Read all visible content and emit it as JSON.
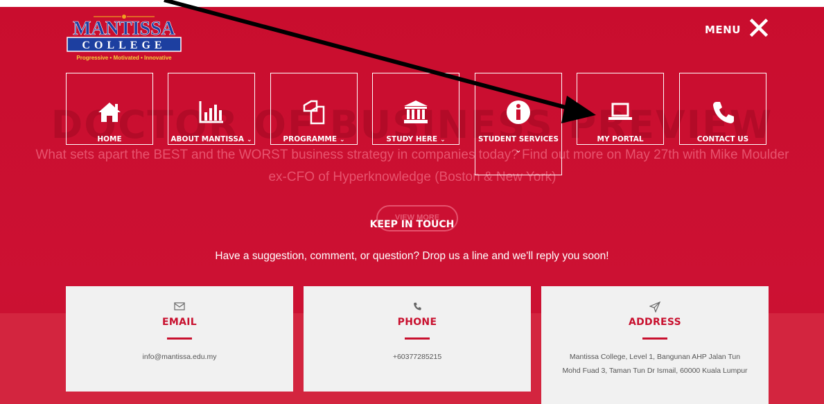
{
  "background": {
    "ghost_title": "DOCTOR OF BUSINESS PREVIEW",
    "ghost_subtitle": "What sets apart the BEST and the WORST business strategy in companies today? Find out more on May 27th with Mike Moulder ex-CFO of Hyperknowledge (Boston & New York)",
    "ghost_button": "VIEW MORE"
  },
  "logo": {
    "name_top": "MANTISSA",
    "name_bottom": "COLLEGE",
    "tagline": "Progressive • Motivated • Innovative"
  },
  "menu": {
    "label": "MENU",
    "icon": "close-icon"
  },
  "nav": [
    {
      "label": "HOME",
      "icon": "home-icon",
      "has_dropdown": false
    },
    {
      "label": "ABOUT MANTISSA",
      "icon": "bar-chart-icon",
      "has_dropdown": true
    },
    {
      "label": "PROGRAMME",
      "icon": "copy-icon",
      "has_dropdown": true
    },
    {
      "label": "STUDY HERE",
      "icon": "institution-icon",
      "has_dropdown": true
    },
    {
      "label": "STUDENT SERVICES",
      "icon": "info-icon",
      "has_dropdown": true
    },
    {
      "label": "MY PORTAL",
      "icon": "laptop-icon",
      "has_dropdown": false
    },
    {
      "label": "CONTACT US",
      "icon": "phone-icon",
      "has_dropdown": false
    }
  ],
  "contact": {
    "heading": "KEEP IN TOUCH",
    "subheading": "Have a suggestion, comment, or question? Drop us a line and we'll reply you soon!",
    "cards": [
      {
        "title": "EMAIL",
        "icon": "envelope-icon",
        "text": "info@mantissa.edu.my"
      },
      {
        "title": "PHONE",
        "icon": "phone-icon",
        "text": "+60377285215"
      },
      {
        "title": "ADDRESS",
        "icon": "paper-plane-icon",
        "text_line1": "Mantissa College, Level 1, Bangunan AHP Jalan Tun",
        "text_line2": "Mohd Fuad 3, Taman Tun Dr Ismail, 60000 Kuala Lumpur"
      }
    ]
  },
  "colors": {
    "brand_red": "#c8102e",
    "card_bg": "#f1f1f1",
    "white": "#ffffff",
    "annotation_arrow": "#000000"
  }
}
